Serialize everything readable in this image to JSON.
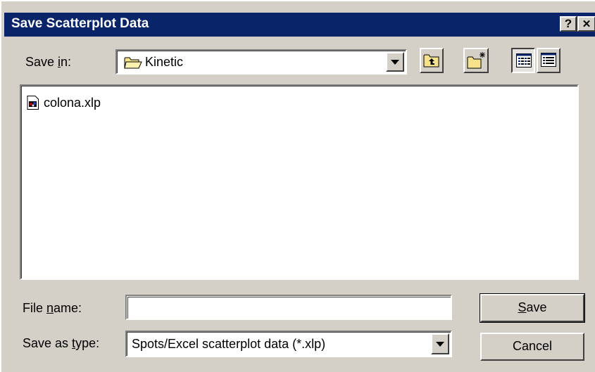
{
  "dialog": {
    "title": "Save Scatterplot Data",
    "help_glyph": "?",
    "close_glyph": "✕"
  },
  "save_in": {
    "label_pre": "Save ",
    "label_key": "i",
    "label_post": "n:",
    "value": "Kinetic",
    "icon": "folder-icon"
  },
  "toolbar": {
    "up_icon": "up-one-level-icon",
    "new_folder_icon": "new-folder-icon",
    "list_icon": "list-view-icon",
    "details_icon": "details-view-icon"
  },
  "files": [
    {
      "name": "colona.xlp",
      "icon": "xlp-file-icon"
    }
  ],
  "file_name": {
    "label_pre": "File ",
    "label_key": "n",
    "label_post": "ame:",
    "value": ""
  },
  "save_as_type": {
    "label_pre": "Save as ",
    "label_key": "t",
    "label_post": "ype:",
    "value": "Spots/Excel scatterplot data (*.xlp)"
  },
  "buttons": {
    "save_key": "S",
    "save_rest": "ave",
    "cancel": "Cancel"
  },
  "colors": {
    "titlebar": "#0a246a",
    "face": "#d4d0c8",
    "folder": "#f6e28a"
  }
}
